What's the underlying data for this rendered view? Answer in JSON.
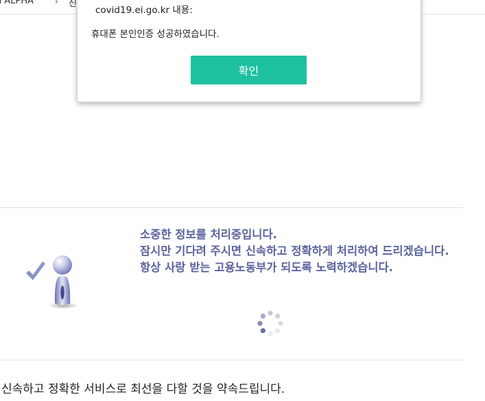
{
  "browser": {
    "tab_text": "d ALPHA",
    "tab_fragment": "신"
  },
  "dialog": {
    "title": "covid19.ei.go.kr 내용:",
    "message": "휴대폰 본인인증 성공하였습니다.",
    "ok_label": "확인",
    "button_color": "#1dc0a1"
  },
  "processing": {
    "line1": "소중한 정보를 처리중입니다.",
    "line2": "잠시만 기다려 주시면 신속하고 정확하게 처리하여 드리겠습니다.",
    "line3": "항상 사랑 받는 고용노동부가 되도록 노력하겠습니다.",
    "text_color": "#5b639e",
    "mascot_icon": "check-person-icon",
    "spinner_icon": "loading-spinner-icon"
  },
  "footer": {
    "text": "신속하고 정확한 서비스로 최선을 다할 것을 약속드립니다."
  }
}
